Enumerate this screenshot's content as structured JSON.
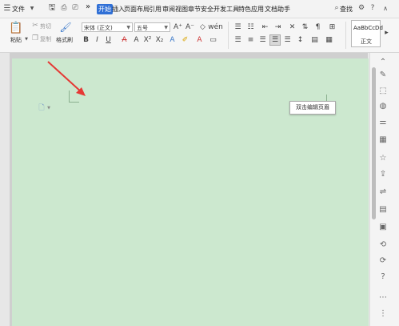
{
  "menubar": {
    "file_label": "文件",
    "tabs": [
      {
        "label": "开始",
        "active": true
      },
      {
        "label": "插入",
        "active": false
      },
      {
        "label": "页面布局",
        "active": false
      },
      {
        "label": "引用",
        "active": false
      },
      {
        "label": "审阅",
        "active": false
      },
      {
        "label": "视图",
        "active": false
      },
      {
        "label": "章节",
        "active": false
      },
      {
        "label": "安全",
        "active": false
      },
      {
        "label": "开发工具",
        "active": false
      },
      {
        "label": "特色应用",
        "active": false
      },
      {
        "label": "文档助手",
        "active": false
      }
    ],
    "search_label": "查找",
    "more_glyph": "»"
  },
  "ribbon": {
    "paste_label": "粘贴",
    "cut_label": "剪切",
    "copy_label": "复制",
    "format_painter_label": "格式刷",
    "font_name": "宋体 (正文)",
    "font_size": "五号",
    "style_preview": "AaBbCcDd",
    "style_name": "正文"
  },
  "document": {
    "header_tooltip": "双击编辑页眉"
  },
  "colors": {
    "page_bg": "#cce8cf",
    "accent": "#2f6fd6",
    "arrow": "#e53935"
  }
}
